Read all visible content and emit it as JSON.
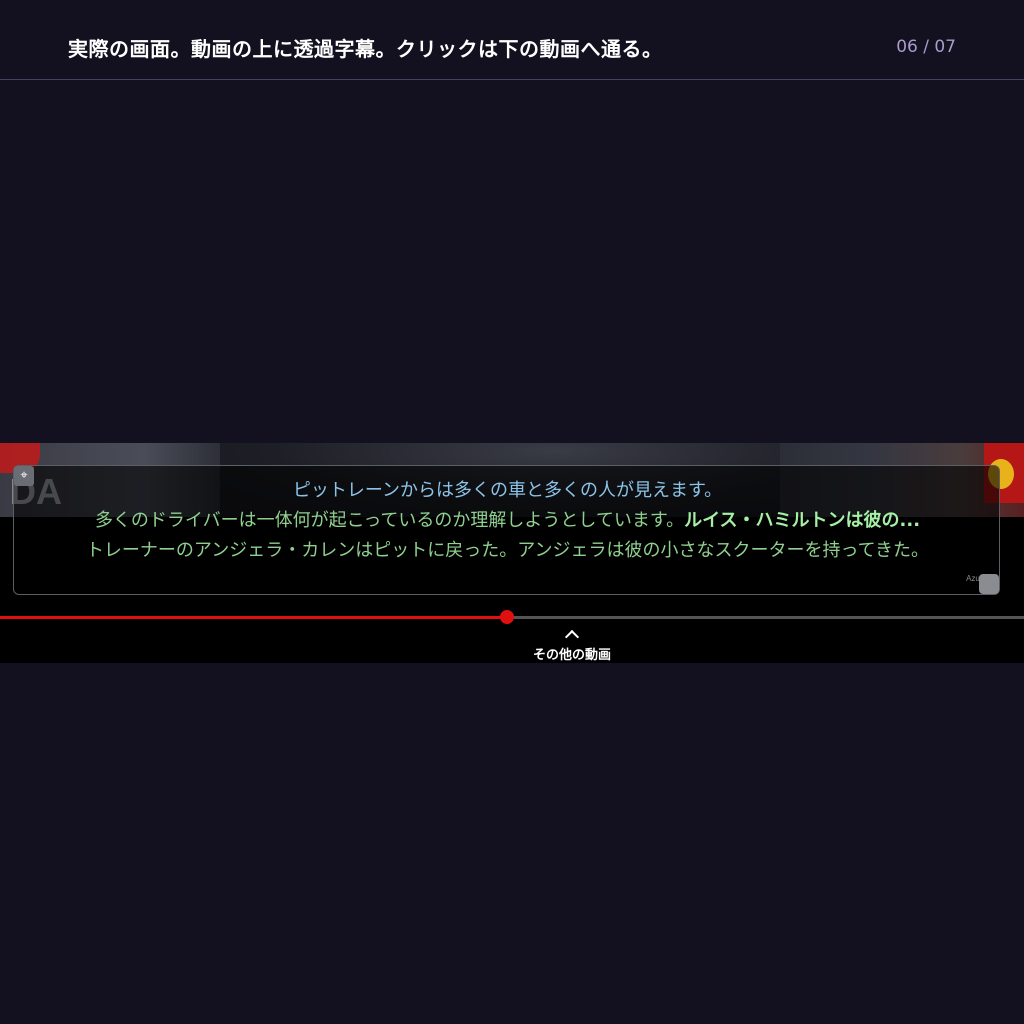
{
  "header": {
    "title": "実際の画面。動画の上に透過字幕。クリックは下の動画へ通る。",
    "counter": "06 / 07"
  },
  "video": {
    "frame_text": "DA"
  },
  "subtitles": {
    "line1": "ピットレーンからは多くの車と多くの人が見えます。",
    "line2_normal": "多くのドライバーは一体何が起こっているのか理解しようとしています。",
    "line2_bold": "ルイス・ハミルトンは彼の...",
    "line3": "トレーナーのアンジェラ・カレンはピットに戻った。アンジェラは彼の小さなスクーターを持ってきた。",
    "provider": "Azure",
    "drag_icon": "move-icon",
    "resize_icon": "resize-icon"
  },
  "player": {
    "progress_fraction": 0.495,
    "more_videos_label": "その他の動画",
    "more_videos_icon": "chevron-up-icon"
  },
  "colors": {
    "background": "#13101f",
    "progress": "#e01010",
    "subtitle_line1": "#8cc4e8",
    "subtitle_green": "#8fd08f"
  }
}
